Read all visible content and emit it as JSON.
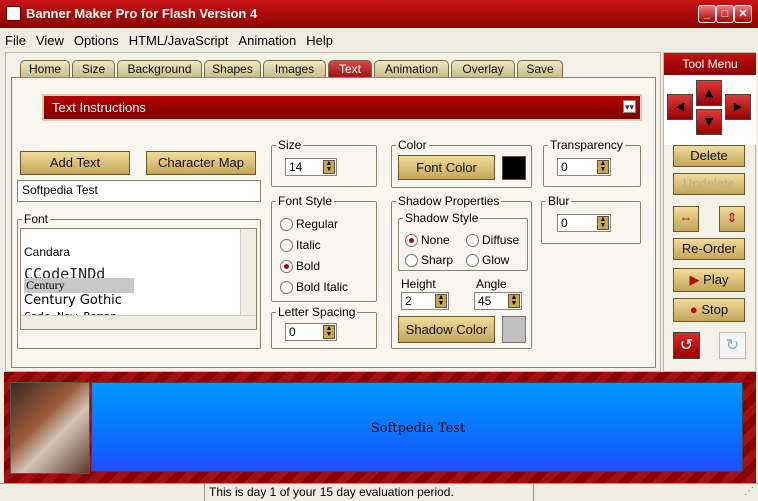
{
  "window": {
    "title": "Banner Maker Pro for Flash Version 4"
  },
  "menu": [
    "File",
    "View",
    "Options",
    "HTML/JavaScript",
    "Animation",
    "Help"
  ],
  "tabs": [
    "Home",
    "Size",
    "Background",
    "Shapes",
    "Images",
    "Text",
    "Animation",
    "Overlay",
    "Save"
  ],
  "active_tab": "Text",
  "instructions": {
    "label": "Text Instructions"
  },
  "text_panel": {
    "add_text": "Add Text",
    "character_map": "Character Map",
    "text_value": "Softpedia Test",
    "font_group": "Font",
    "fonts": [
      "Candara",
      "CCodeINDd",
      "Century",
      "Century Gothic",
      "Code New Roman"
    ],
    "selected_font": "Century",
    "size_group": "Size",
    "size_value": "14",
    "font_style_group": "Font Style",
    "styles": [
      "Regular",
      "Italic",
      "Bold",
      "Bold Italic"
    ],
    "selected_style": "Bold",
    "letter_spacing_group": "Letter Spacing",
    "letter_spacing_value": "0",
    "color_group": "Color",
    "font_color_btn": "Font Color",
    "font_color": "#000000",
    "shadow_group": "Shadow Properties",
    "shadow_style_group": "Shadow Style",
    "shadow_styles": [
      "None",
      "Diffuse",
      "Sharp",
      "Glow"
    ],
    "selected_shadow": "None",
    "height_label": "Height",
    "height_value": "2",
    "angle_label": "Angle",
    "angle_value": "45",
    "shadow_color_btn": "Shadow Color",
    "shadow_color": "#c0c0c0",
    "transparency_group": "Transparency",
    "transparency_value": "0",
    "blur_group": "Blur",
    "blur_value": "0"
  },
  "tool_menu": {
    "title": "Tool Menu",
    "delete": "Delete",
    "undelete": "Undelete",
    "reorder": "Re-Order",
    "play": "Play",
    "stop": "Stop"
  },
  "preview": {
    "banner_text": "Softpedia Test"
  },
  "status": {
    "message": "This is day 1 of your 15 day evaluation period."
  },
  "colors": {
    "brand_red": "#a30000",
    "gold": "#d4b56a",
    "banner_blue": "#0b6fff"
  }
}
